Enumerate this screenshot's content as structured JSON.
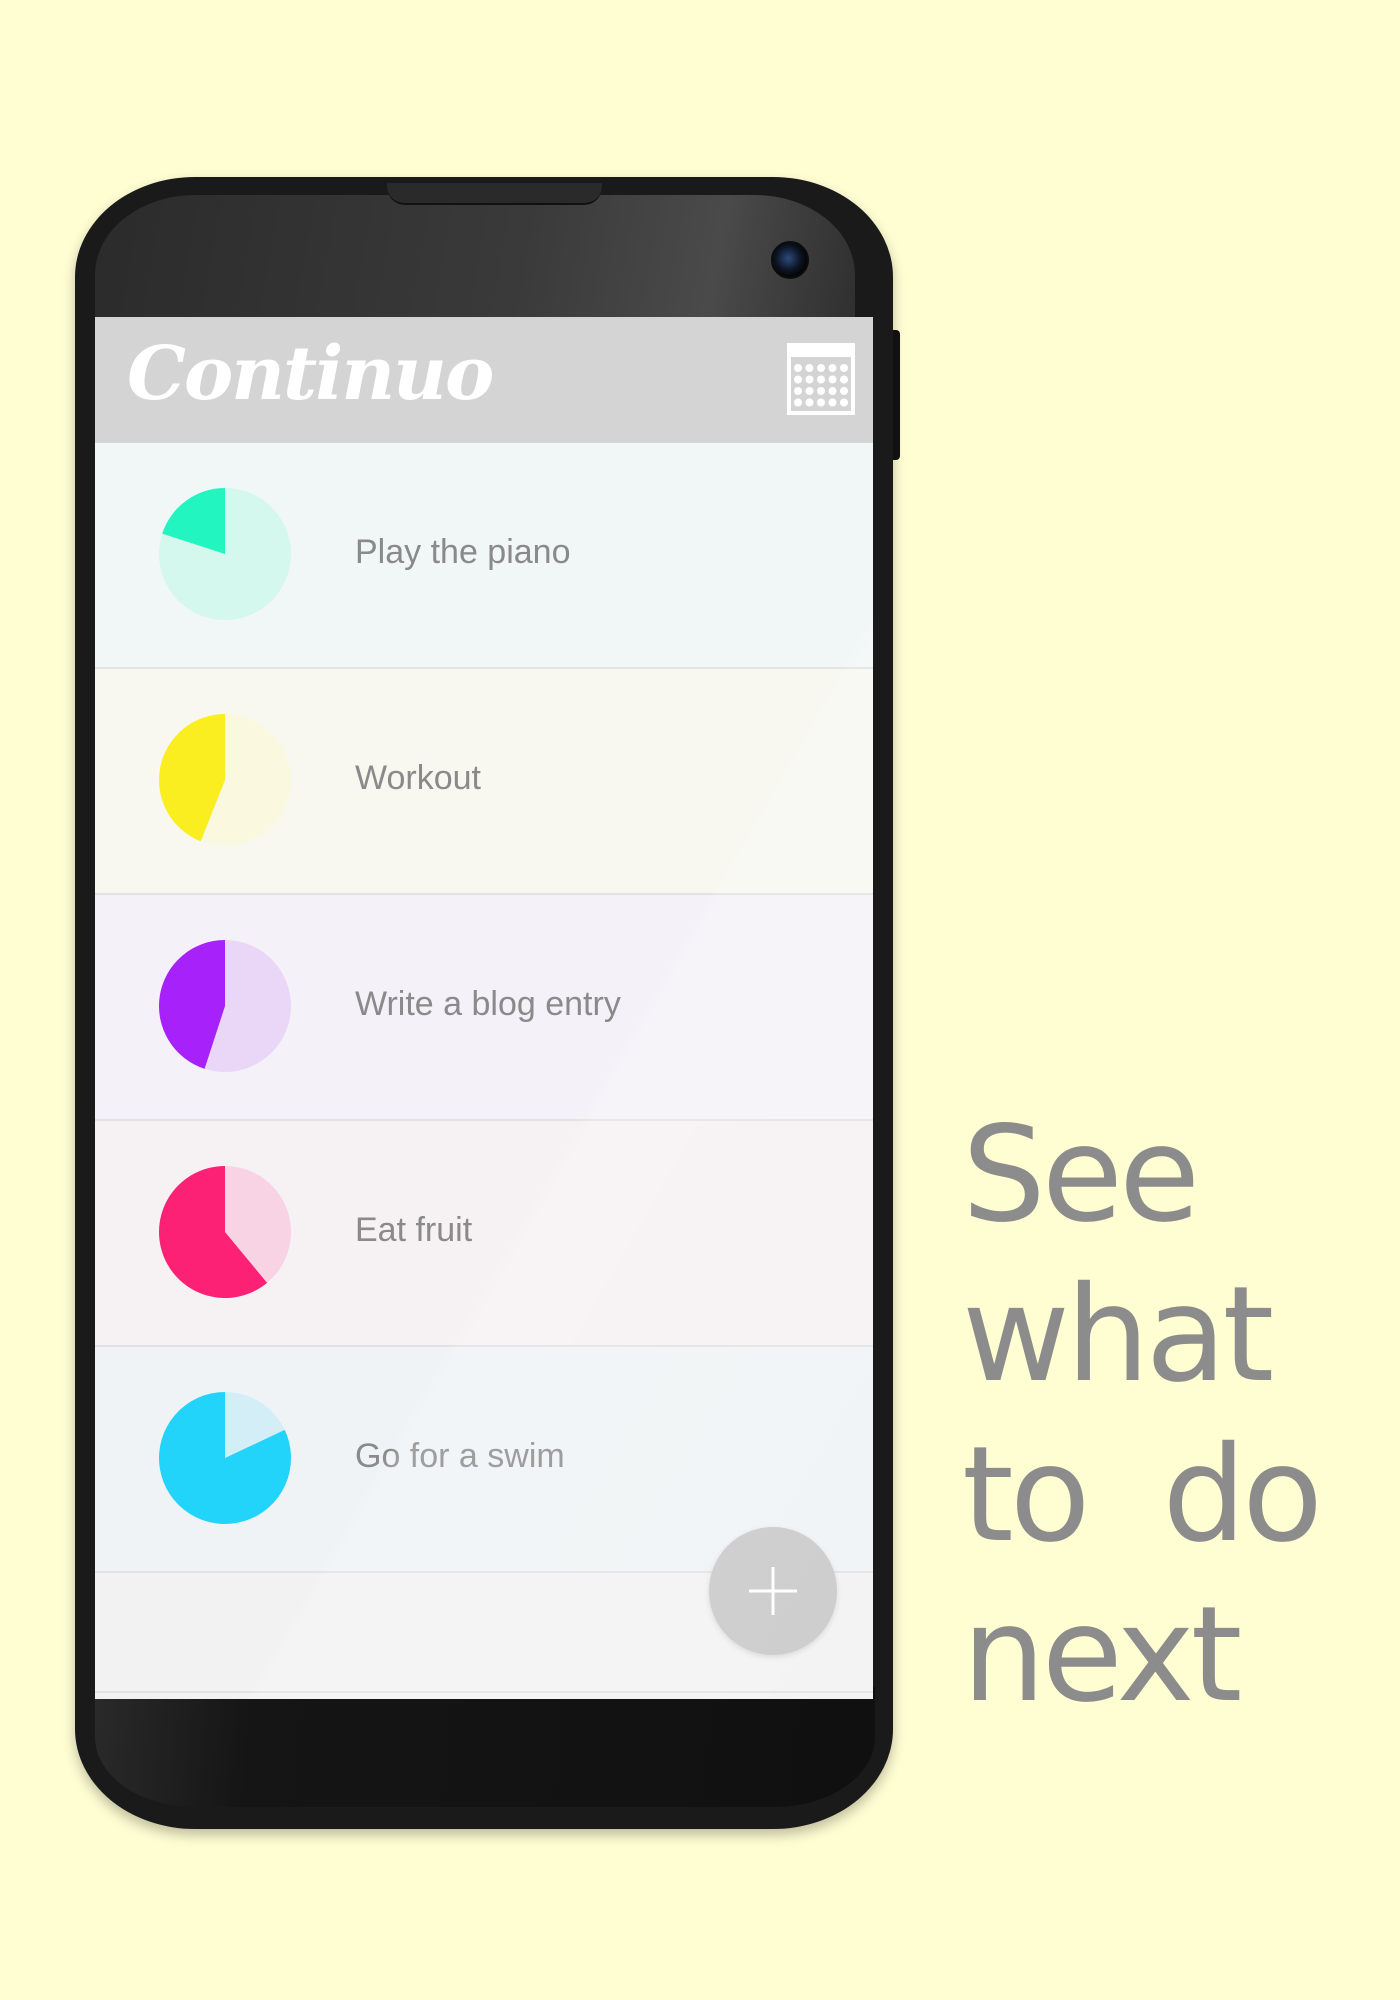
{
  "app": {
    "title": "Continuo"
  },
  "header": {
    "calendar_icon": "calendar-grid-icon"
  },
  "tasks": [
    {
      "label": "Play the piano",
      "progress": 0.2,
      "color": "#22F5C0",
      "track": "#D4F7EE",
      "row_bg": "#F1F7F6"
    },
    {
      "label": "Workout",
      "progress": 0.44,
      "color": "#FAEE20",
      "track": "#FAF9E0",
      "row_bg": "#F8F8F1"
    },
    {
      "label": "Write a blog entry",
      "progress": 0.45,
      "color": "#A621FA",
      "track": "#EAD6F7",
      "row_bg": "#F4F1F8"
    },
    {
      "label": "Eat fruit",
      "progress": 0.61,
      "color": "#FC2175",
      "track": "#F8D3E3",
      "row_bg": "#F6F1F3"
    },
    {
      "label": "Go for a swim",
      "progress": 0.82,
      "color": "#22D3FA",
      "track": "#D4EEF7",
      "row_bg": "#EFF3F5"
    }
  ],
  "fab": {
    "icon": "plus-icon"
  },
  "tagline": {
    "lines": [
      "See",
      "what",
      "to  do",
      "next"
    ]
  },
  "colors": {
    "background": "#FFFDD2",
    "app_bar": "#D4D4D4",
    "text_gray": "#8A8A8A",
    "fab": "#C8C8C8"
  }
}
